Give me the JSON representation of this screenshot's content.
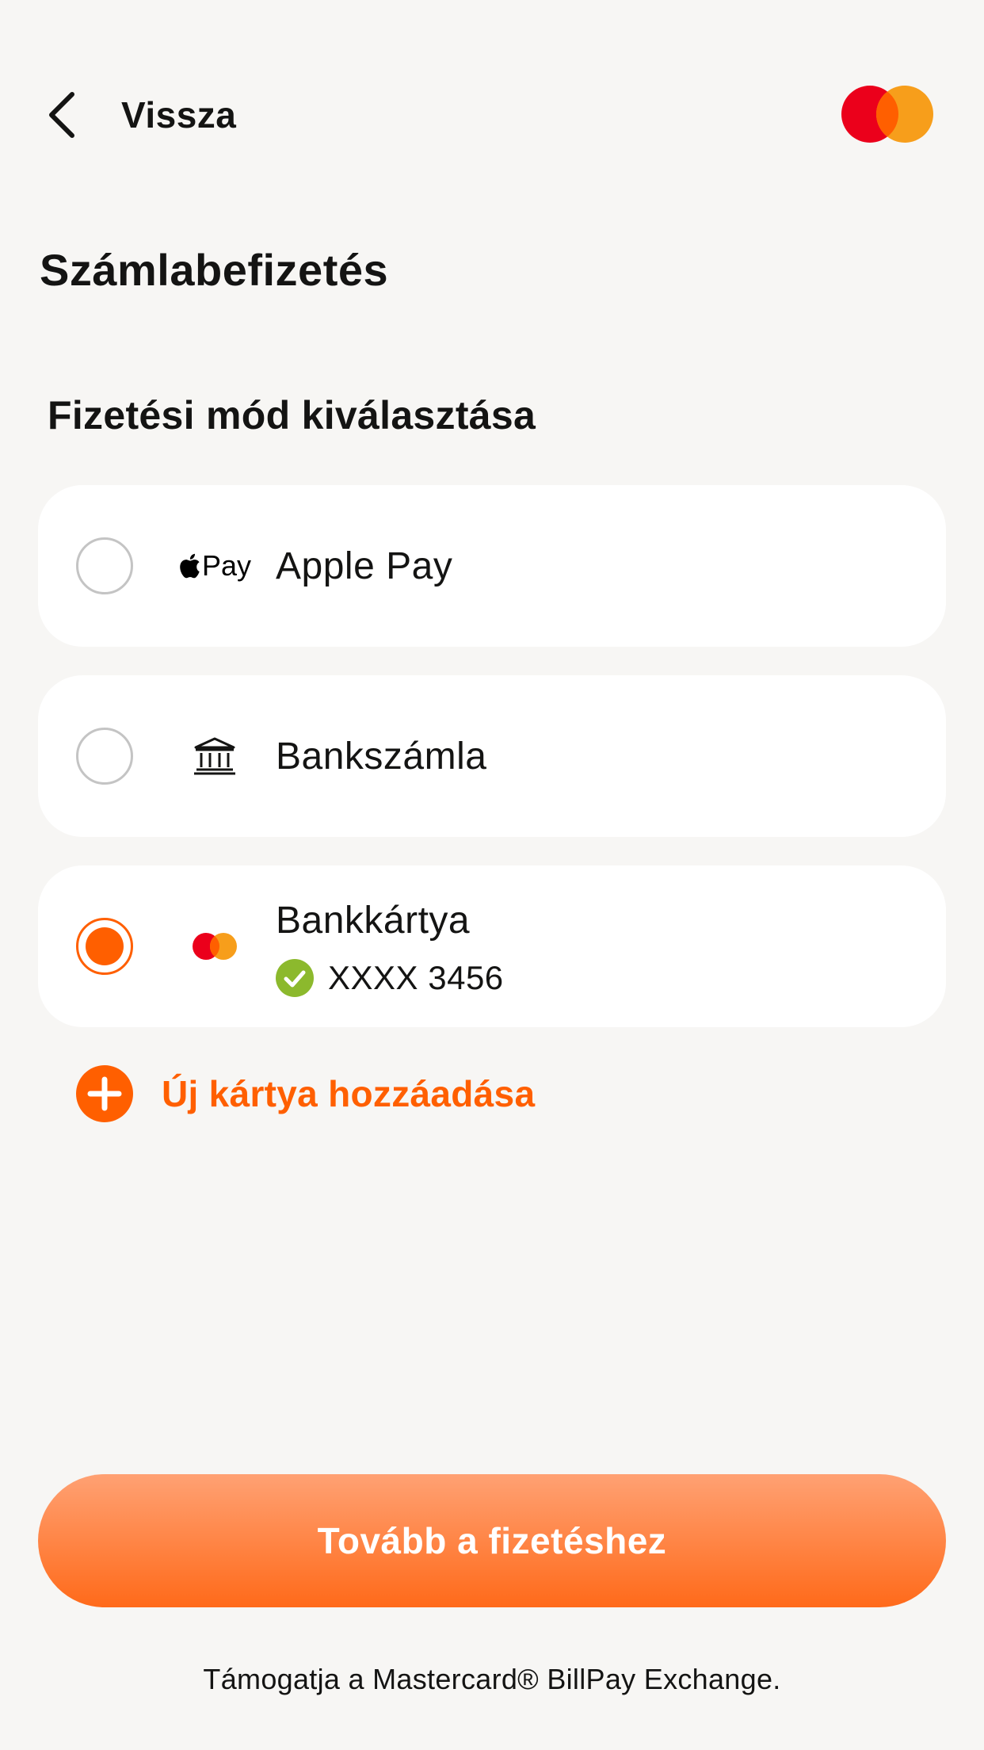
{
  "header": {
    "back_label": "Vissza",
    "logo_icon": "mastercard-logo"
  },
  "page_title": "Számlabefizetés",
  "section_title": "Fizetési mód kiválasztása",
  "payment_methods": [
    {
      "label": "Apple Pay",
      "icon": "apple-pay-icon",
      "icon_text": "Pay",
      "selected": false
    },
    {
      "label": "Bankszámla",
      "icon": "bank-icon",
      "selected": false
    },
    {
      "label": "Bankkártya",
      "icon": "mastercard-icon",
      "selected": true,
      "card_number": "XXXX 3456",
      "verified_icon": "check-circle-icon"
    }
  ],
  "add_card_label": "Új kártya hozzáadása",
  "continue_label": "Tovább a fizetéshez",
  "footer_note": "Támogatja a Mastercard® BillPay Exchange.",
  "colors": {
    "accent": "#ff5f00",
    "mastercard_red": "#eb001b",
    "mastercard_orange": "#f79e1b",
    "verified_green": "#8cb92d",
    "background": "#f7f6f4"
  }
}
